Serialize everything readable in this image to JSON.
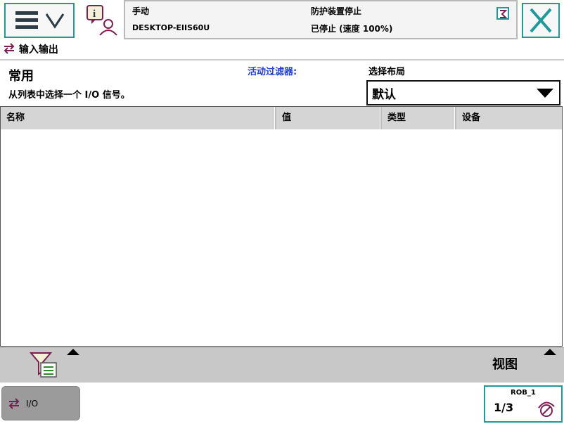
{
  "colors": {
    "accent": "#1d9a9a",
    "filter_label": "#1f3fd6",
    "header_bg": "#d5d5d5",
    "bar_bg": "#c8c8c8"
  },
  "icons": {
    "menu": "hamburger-chevron-icon",
    "info": "info-user-icon",
    "close": "close-icon",
    "io": "io-arrows-icon",
    "filter": "filter-funnel-icon",
    "jog": "jog-quickset-icon"
  },
  "status": {
    "mode": "手动",
    "controller": "DESKTOP-EIIS60U",
    "safety": "防护装置停止",
    "run_state": "已停止 (速度 100%)"
  },
  "breadcrumb": "输入输出",
  "header": {
    "title": "常用",
    "instruction": "从列表中选择一个 I/O 信号。",
    "filter_label": "活动过滤器:",
    "layout_label": "选择布局",
    "layout_value": "默认"
  },
  "table": {
    "columns": [
      "名称",
      "值",
      "类型",
      "设备"
    ],
    "rows": []
  },
  "bottom": {
    "view_label": "视图"
  },
  "taskbar": {
    "io_label": "I/O",
    "robot": "ROB_1",
    "fraction": "1/3"
  }
}
